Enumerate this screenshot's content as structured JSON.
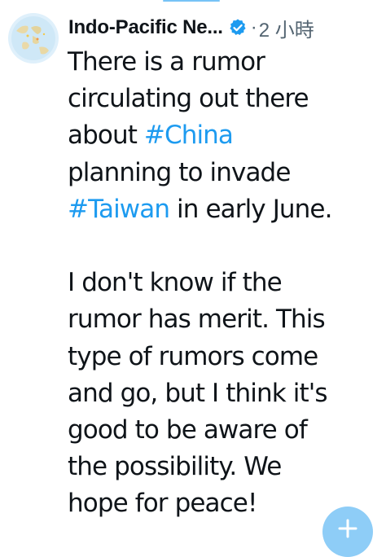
{
  "tweet": {
    "author": {
      "display_name": "Indo-Pacific Ne...",
      "verified": true,
      "avatar": "globe-map-avatar"
    },
    "meta": {
      "separator": "·",
      "time": "2 小時"
    },
    "lines": [
      [
        {
          "text": "There is a rumor"
        }
      ],
      [
        {
          "text": "circulating out there"
        }
      ],
      [
        {
          "text": "about "
        },
        {
          "text": "#China",
          "hashtag": true
        }
      ],
      [
        {
          "text": "planning to invade"
        }
      ],
      [
        {
          "text": "#Taiwan",
          "hashtag": true
        },
        {
          "text": " in early June."
        }
      ],
      [],
      [
        {
          "text": "I don't know if the"
        }
      ],
      [
        {
          "text": "rumor has merit. This"
        }
      ],
      [
        {
          "text": "type of rumors come"
        }
      ],
      [
        {
          "text": "and go, but I think it's"
        }
      ],
      [
        {
          "text": "good to be aware of"
        }
      ],
      [
        {
          "text": "the possibility. We"
        }
      ],
      [
        {
          "text": "hope for peace!"
        }
      ]
    ]
  },
  "compose_button": {
    "icon": "compose-plus-icon"
  },
  "colors": {
    "text": "#0f1419",
    "secondary": "#536471",
    "link": "#1d9bf0",
    "fab": "#8ecdf7"
  }
}
